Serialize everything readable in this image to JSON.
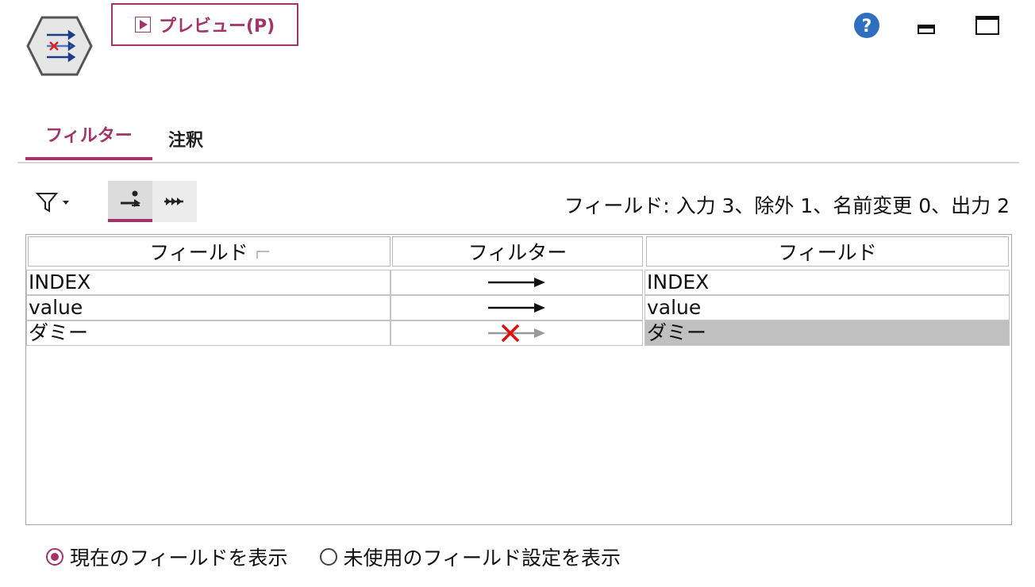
{
  "toolbar": {
    "preview_label": "プレビュー(P)"
  },
  "window": {
    "help_icon": "help-icon",
    "minimize_icon": "minimize-icon",
    "maximize_icon": "maximize-icon"
  },
  "tabs": [
    {
      "label": "フィルター",
      "active": true
    },
    {
      "label": "注釈",
      "active": false
    }
  ],
  "summary": "フィールド: 入力 3、除外 1、名前変更 0、出力 2",
  "table": {
    "headers": [
      "フィールド",
      "フィルター",
      "フィールド"
    ],
    "rows": [
      {
        "input": "INDEX",
        "filter": "pass",
        "output": "INDEX"
      },
      {
        "input": "value",
        "filter": "pass",
        "output": "value"
      },
      {
        "input": "ダミー",
        "filter": "excluded",
        "output": "ダミー"
      }
    ]
  },
  "options": [
    {
      "label": "現在のフィールドを表示",
      "selected": true
    },
    {
      "label": "未使用のフィールド設定を表示",
      "selected": false
    }
  ],
  "colors": {
    "accent": "#a3336b",
    "help_blue": "#2f6fc0",
    "exclude_red": "#e01010"
  }
}
